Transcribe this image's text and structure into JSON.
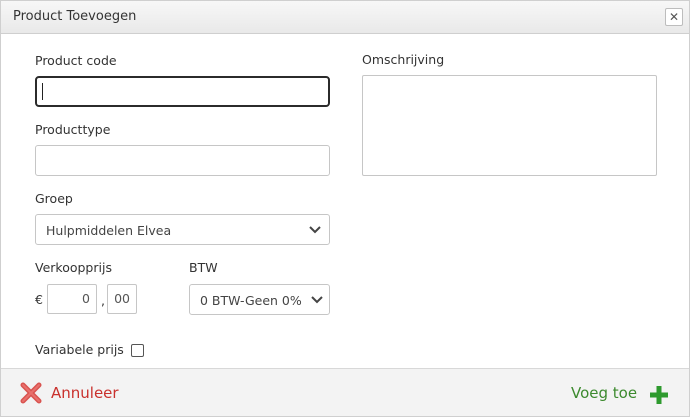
{
  "dialog": {
    "title": "Product Toevoegen",
    "close_icon": "close-icon",
    "colors": {
      "cancel": "#c9302c",
      "add": "#3c8a2e",
      "focus_border": "#2b2b2b"
    }
  },
  "form": {
    "product_code": {
      "label": "Product code",
      "value": ""
    },
    "producttype": {
      "label": "Producttype",
      "value": ""
    },
    "groep": {
      "label": "Groep",
      "selected": "Hulpmiddelen Elvea"
    },
    "verkoopprijs": {
      "label": "Verkoopprijs",
      "currency": "€",
      "euros": "0",
      "separator": ",",
      "cents": "00"
    },
    "btw": {
      "label": "BTW",
      "selected": "0 BTW-Geen 0%"
    },
    "omschrijving": {
      "label": "Omschrijving",
      "value": ""
    },
    "variabele_prijs": {
      "label": "Variabele prijs",
      "checked": false
    }
  },
  "footer": {
    "cancel_label": "Annuleer",
    "cancel_icon": "x-icon",
    "add_label": "Voeg toe",
    "add_icon": "plus-icon"
  }
}
